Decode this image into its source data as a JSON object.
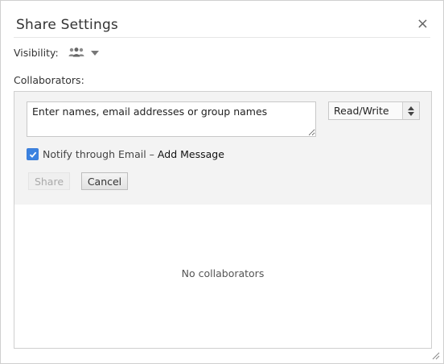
{
  "dialog": {
    "title": "Share Settings",
    "close_symbol": "×",
    "close_icon": "close-icon",
    "resize_icon": "resize-grip-icon"
  },
  "visibility": {
    "label": "Visibility:",
    "icon": "people-group-icon",
    "dropdown_icon": "chevron-down-icon"
  },
  "collaborators": {
    "label": "Collaborators:",
    "input_placeholder": "Enter names, email addresses or group names",
    "input_value": "",
    "permission_selected": "Read/Write",
    "notify_checked": true,
    "notify_label": "Notify through Email –",
    "add_message_link": "Add Message",
    "share_button": "Share",
    "cancel_button": "Cancel",
    "empty_message": "No collaborators"
  },
  "colors": {
    "checkbox_accent": "#3b82e0",
    "panel_background": "#f3f3f3"
  }
}
